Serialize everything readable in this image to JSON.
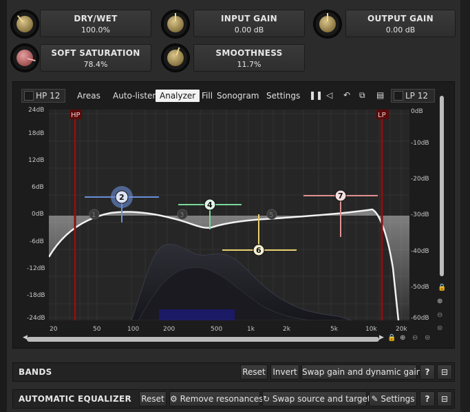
{
  "params": {
    "dry_wet": {
      "label": "DRY/WET",
      "value": "100.0%"
    },
    "input_gain": {
      "label": "INPUT GAIN",
      "value": "0.00 dB"
    },
    "output_gain": {
      "label": "OUTPUT GAIN",
      "value": "0.00 dB"
    },
    "soft_saturation": {
      "label": "SOFT SATURATION",
      "value": "78.4%"
    },
    "smoothness": {
      "label": "SMOOTHNESS",
      "value": "11.7%"
    }
  },
  "toolbar": {
    "hp": "HP 12",
    "areas": "Areas",
    "autolisten": "Auto-listen",
    "analyzer": "Analyzer",
    "fill": "Fill",
    "sonogram": "Sonogram",
    "settings": "Settings",
    "lp": "LP 12"
  },
  "graph": {
    "hp_marker": "HP",
    "lp_marker": "LP",
    "left_axis": [
      "24dB",
      "18dB",
      "12dB",
      "6dB",
      "0dB",
      "-6dB",
      "-12dB",
      "-18dB",
      "-24dB"
    ],
    "right_axis": [
      "0dB",
      "-10dB",
      "-20dB",
      "-30dB",
      "-40dB",
      "-50dB",
      "-60dB"
    ],
    "x_axis": [
      "20",
      "50",
      "100",
      "200",
      "500",
      "1k",
      "2k",
      "5k",
      "10k",
      "20k"
    ],
    "bands": [
      "1",
      "2",
      "3",
      "4",
      "5",
      "6",
      "7"
    ]
  },
  "bands_section": {
    "title": "BANDS",
    "reset": "Reset",
    "invert": "Invert",
    "swap": "Swap gain and dynamic gain",
    "help": "?"
  },
  "auto_eq_section": {
    "title": "AUTOMATIC EQUALIZER",
    "reset": "Reset",
    "remove": "Remove resonances",
    "swap": "Swap source and target",
    "settings": "Settings",
    "help": "?"
  },
  "colors": {
    "accent_active": "#f2f2f2",
    "hp_lp_marker": "#8b1010",
    "band2": "#6a8fd8",
    "band4": "#7ad89a",
    "band6": "#e8d070",
    "band7": "#e09090"
  }
}
